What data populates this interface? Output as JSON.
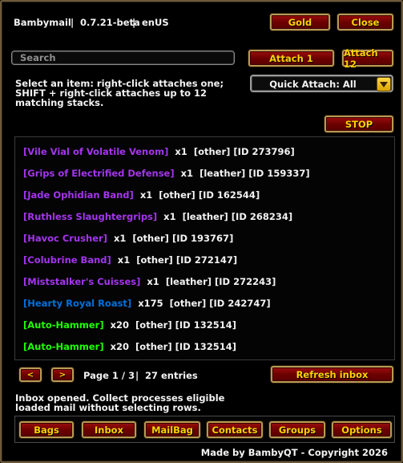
{
  "header": {
    "app_name": "Bambymail",
    "version": "0.7.21-beta",
    "locale": "enUS",
    "separator": "|",
    "gold_label": "Gold",
    "close_label": "Close"
  },
  "search": {
    "placeholder": "Search"
  },
  "attach": {
    "attach1_label": "Attach 1",
    "attach12_label": "Attach 12",
    "quick_attach_label": "Quick Attach: All",
    "stop_label": "STOP"
  },
  "hint_text": "Select an item: right-click attaches one; SHIFT + right-click attaches up to 12 matching stacks.",
  "colors": {
    "epic": "#a335ee",
    "rare": "#0070dd",
    "uncommon": "#1eff00",
    "gold_text": "#ffd100",
    "frame_border": "#6d5a3a"
  },
  "items": [
    {
      "name": "[Vile Vial of Volatile Venom]",
      "qty": "x1",
      "type": "[other]",
      "id": "[ID 273796]",
      "quality": "epic"
    },
    {
      "name": "[Grips of Electrified Defense]",
      "qty": "x1",
      "type": "[leather]",
      "id": "[ID 159337]",
      "quality": "epic"
    },
    {
      "name": "[Jade Ophidian Band]",
      "qty": "x1",
      "type": "[other]",
      "id": "[ID 162544]",
      "quality": "epic"
    },
    {
      "name": "[Ruthless Slaughtergrips]",
      "qty": "x1",
      "type": "[leather]",
      "id": "[ID 268234]",
      "quality": "epic"
    },
    {
      "name": "[Havoc Crusher]",
      "qty": "x1",
      "type": "[other]",
      "id": "[ID 193767]",
      "quality": "epic"
    },
    {
      "name": "[Colubrine Band]",
      "qty": "x1",
      "type": "[other]",
      "id": "[ID 272147]",
      "quality": "epic"
    },
    {
      "name": "[Miststalker's Cuisses]",
      "qty": "x1",
      "type": "[leather]",
      "id": "[ID 272243]",
      "quality": "epic"
    },
    {
      "name": "[Hearty Royal Roast]",
      "qty": "x175",
      "type": "[other]",
      "id": "[ID 242747]",
      "quality": "rare"
    },
    {
      "name": "[Auto-Hammer]",
      "qty": "x20",
      "type": "[other]",
      "id": "[ID 132514]",
      "quality": "uncommon"
    },
    {
      "name": "[Auto-Hammer]",
      "qty": "x20",
      "type": "[other]",
      "id": "[ID 132514]",
      "quality": "uncommon"
    }
  ],
  "pagination": {
    "prev_label": "<",
    "next_label": ">",
    "page_text": "Page 1 / 3",
    "separator": "|",
    "entries_text": "27 entries",
    "refresh_label": "Refresh inbox"
  },
  "status_text": "Inbox opened. Collect processes eligible loaded mail without selecting rows.",
  "nav": [
    "Bags",
    "Inbox",
    "MailBag",
    "Contacts",
    "Groups",
    "Options"
  ],
  "footer_text": "Made by BambyQT - Copyright 2026"
}
